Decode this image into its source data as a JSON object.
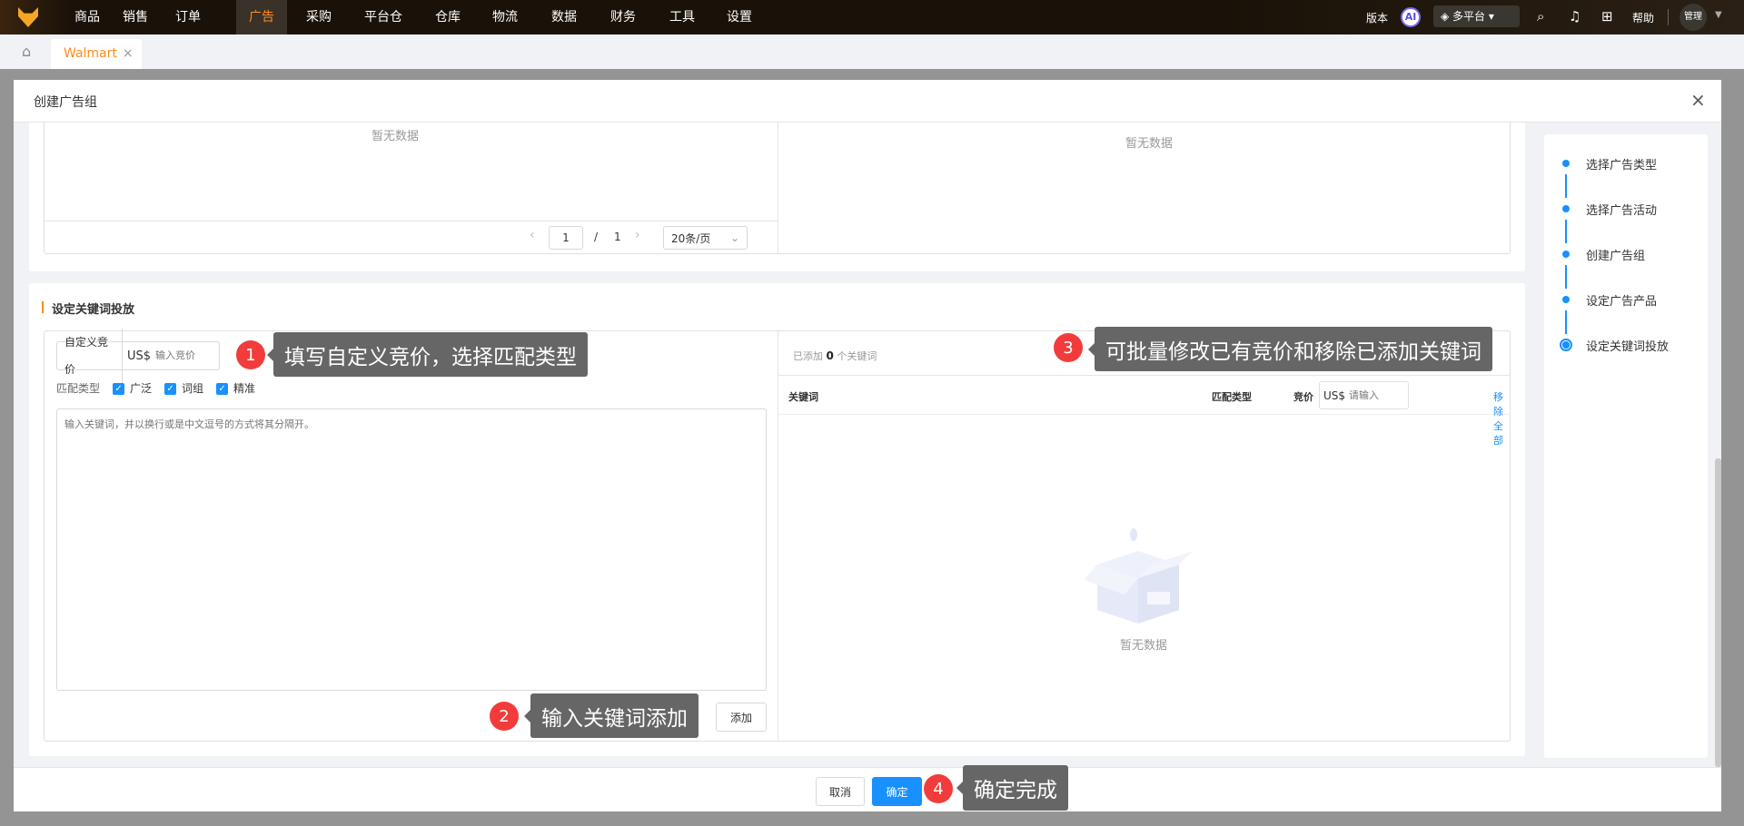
{
  "topnav": {
    "items": [
      "商品",
      "销售",
      "订单",
      "广告",
      "采购",
      "平台仓",
      "仓库",
      "物流",
      "数据",
      "财务",
      "工具",
      "设置"
    ],
    "active": "广告",
    "version": "版本",
    "ai": "AI",
    "platform": "多平台",
    "help": "帮助",
    "user": "管理"
  },
  "tabs": {
    "active": "Walmart"
  },
  "modal": {
    "title": "创建广告组"
  },
  "upper": {
    "left_empty": "暂无数据",
    "right_empty": "暂无数据",
    "page": "1",
    "separator": "/",
    "total_pages": "1",
    "page_size": "20条/页"
  },
  "keyword": {
    "section_title": "设定关键词投放",
    "custom_bid_label": "自定义竞价",
    "currency": "US$",
    "bid_placeholder": "输入竞价",
    "match_label": "匹配类型",
    "match_types": [
      {
        "label": "广泛",
        "checked": true
      },
      {
        "label": "词组",
        "checked": true
      },
      {
        "label": "精准",
        "checked": true
      }
    ],
    "textarea_placeholder": "输入关键词，并以换行或是中文逗号的方式将其分隔开。",
    "add_button": "添加",
    "added_prefix": "已添加",
    "added_count": "0",
    "added_suffix": "个关键词",
    "columns": {
      "keyword": "关键词",
      "match_type": "匹配类型",
      "bid": "竞价"
    },
    "bid_currency": "US$",
    "bid_input_placeholder": "请输入",
    "remove_all": "移除全部",
    "empty": "暂无数据"
  },
  "steps": [
    {
      "label": "选择广告类型",
      "status": "done"
    },
    {
      "label": "选择广告活动",
      "status": "done"
    },
    {
      "label": "创建广告组",
      "status": "done"
    },
    {
      "label": "设定广告产品",
      "status": "done"
    },
    {
      "label": "设定关键词投放",
      "status": "current"
    }
  ],
  "footer": {
    "cancel": "取消",
    "confirm": "确定"
  },
  "annotations": [
    {
      "num": "1",
      "text": "填写自定义竞价，选择匹配类型"
    },
    {
      "num": "2",
      "text": "输入关键词添加"
    },
    {
      "num": "3",
      "text": "可批量修改已有竞价和移除已添加关键词"
    },
    {
      "num": "4",
      "text": "确定完成"
    }
  ],
  "colors": {
    "primary": "#1890ff",
    "accent": "#ff8a1f",
    "badge": "#f23c3c"
  }
}
